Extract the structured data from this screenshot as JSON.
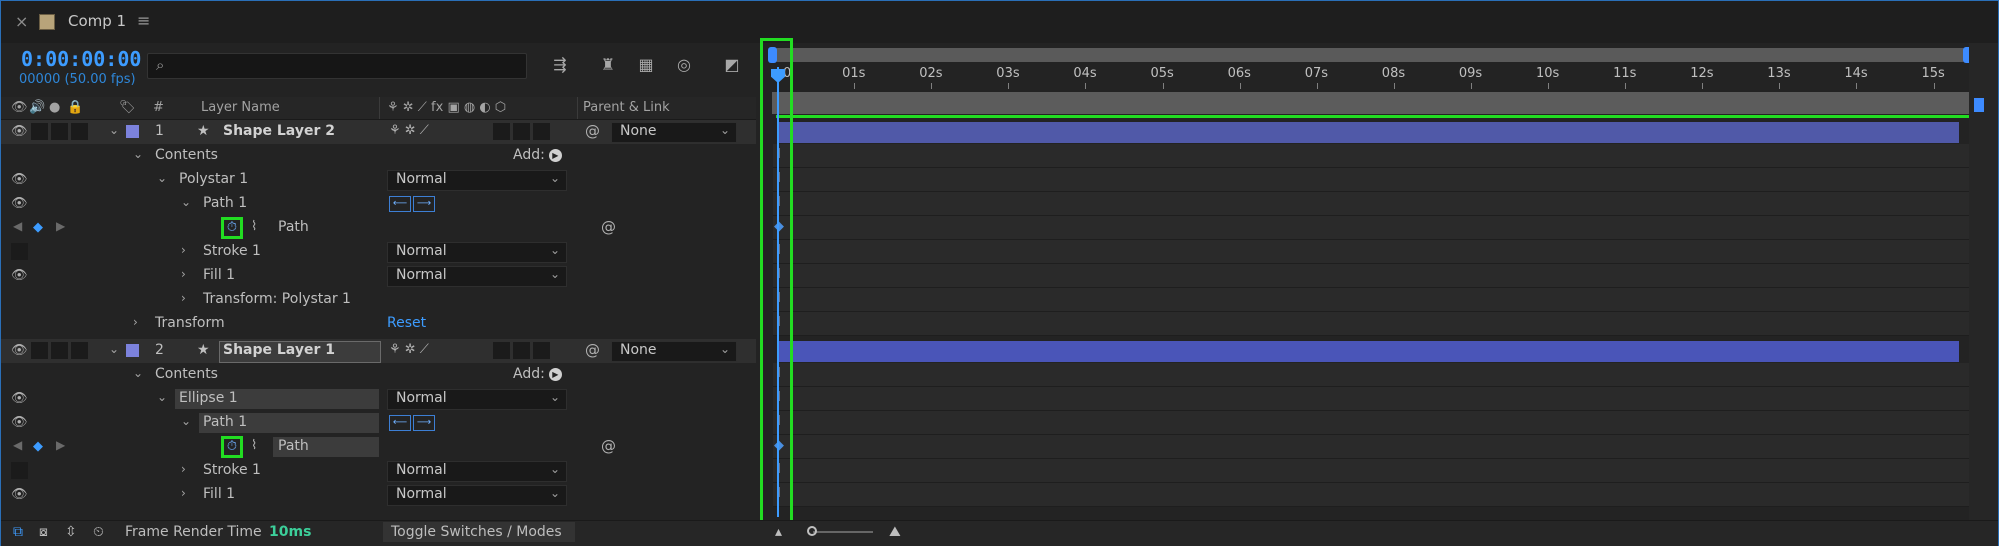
{
  "tab": {
    "close": "×",
    "title": "Comp 1",
    "menu": "≡"
  },
  "time": {
    "timecode": "0:00:00:00",
    "frames": "00000 (50.00 fps)"
  },
  "search": {
    "icon": "⌕",
    "placeholder": ""
  },
  "header": {
    "num": "#",
    "layer_name": "Layer Name",
    "parent_link": "Parent & Link"
  },
  "ruler": {
    "ticks": [
      "0",
      "01s",
      "02s",
      "03s",
      "04s",
      "05s",
      "06s",
      "07s",
      "08s",
      "09s",
      "10s",
      "11s",
      "12s",
      "13s",
      "14s",
      "15s"
    ]
  },
  "rows": {
    "r1": {
      "num": "1",
      "name": "Shape Layer 2",
      "parent": "None"
    },
    "r2": {
      "name": "Contents",
      "add": "Add:"
    },
    "r3": {
      "name": "Polystar 1",
      "mode": "Normal"
    },
    "r4": {
      "name": "Path 1"
    },
    "r5": {
      "name": "Path"
    },
    "r6": {
      "name": "Stroke 1",
      "mode": "Normal"
    },
    "r7": {
      "name": "Fill 1",
      "mode": "Normal"
    },
    "r8": {
      "name": "Transform: Polystar 1"
    },
    "r9": {
      "name": "Transform",
      "reset": "Reset"
    },
    "r10": {
      "num": "2",
      "name": "Shape Layer 1",
      "parent": "None"
    },
    "r11": {
      "name": "Contents",
      "add": "Add:"
    },
    "r12": {
      "name": "Ellipse 1",
      "mode": "Normal"
    },
    "r13": {
      "name": "Path 1"
    },
    "r14": {
      "name": "Path"
    },
    "r15": {
      "name": "Stroke 1",
      "mode": "Normal"
    },
    "r16": {
      "name": "Fill 1",
      "mode": "Normal"
    }
  },
  "bottom": {
    "render_label": "Frame Render Time",
    "render_value": "10ms",
    "toggle": "Toggle Switches / Modes"
  },
  "colors": {
    "accent": "#3d9cff",
    "highlight": "#22dd22",
    "layer_bar": "#5059a8",
    "label": "#7c82dc"
  }
}
